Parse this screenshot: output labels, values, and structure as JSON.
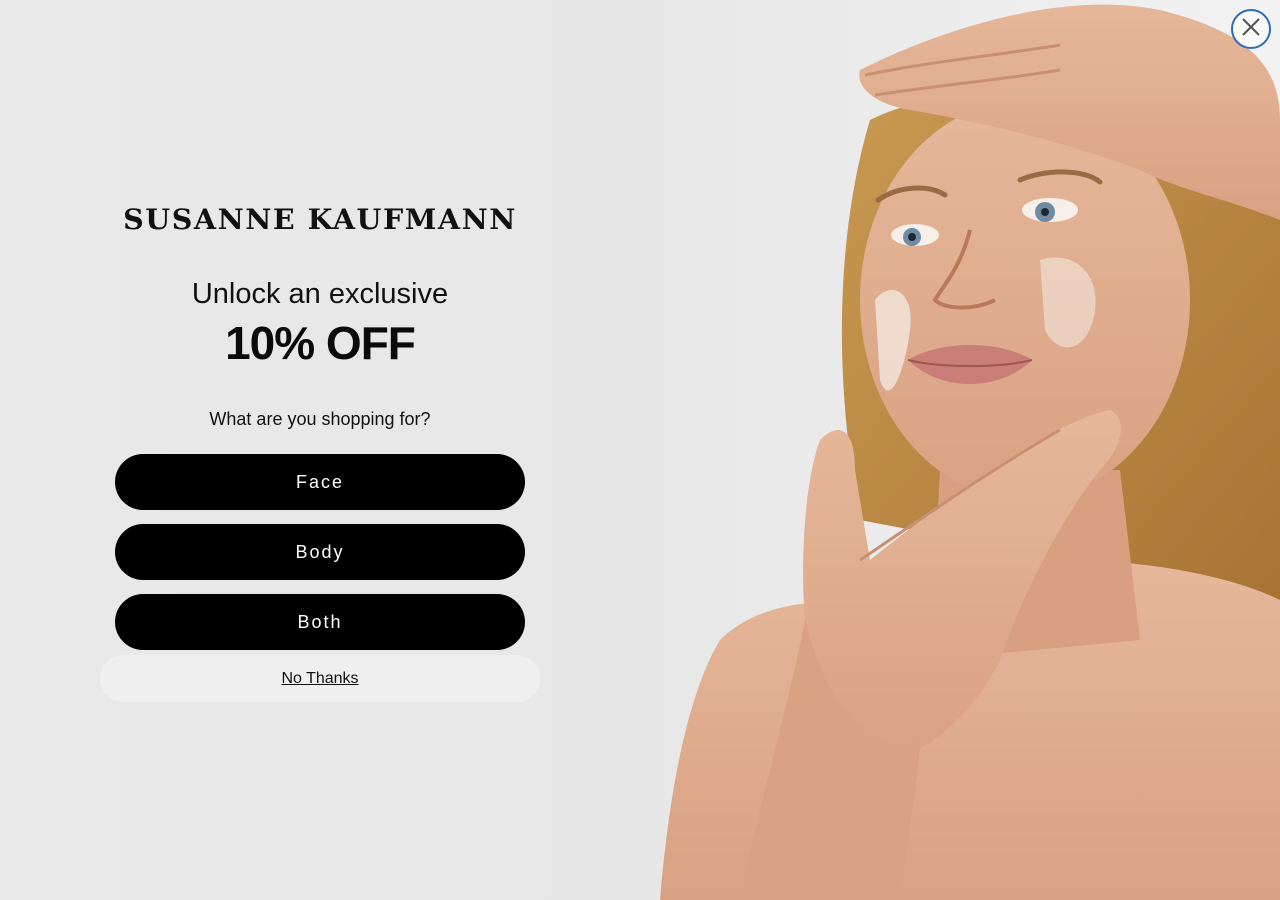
{
  "brand": {
    "name": "SUSANNE KAUFMANN"
  },
  "promo": {
    "headline": "Unlock an exclusive",
    "offer": "10% OFF",
    "question": "What are you shopping for?"
  },
  "choices": [
    {
      "label": "Face"
    },
    {
      "label": "Body"
    },
    {
      "label": "Both"
    }
  ],
  "dismiss": {
    "label": "No Thanks"
  },
  "close": {
    "icon": "close-icon"
  },
  "colors": {
    "background": "#e8e8e8",
    "button": "#000000",
    "button_text": "#ffffff",
    "close_ring": "#2d6db5"
  }
}
